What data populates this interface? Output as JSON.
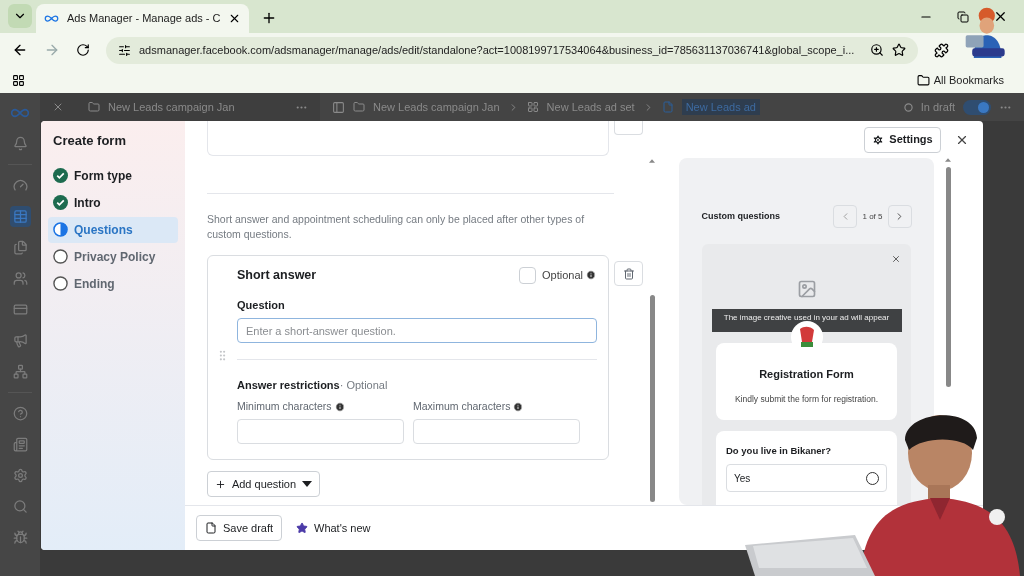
{
  "browser": {
    "tabs": [
      {
        "title": "Ads Manager - Manage ads - C",
        "selected": true
      }
    ],
    "url": "adsmanager.facebook.com/adsmanager/manage/ads/edit/standalone?act=1008199717534064&business_id=785631137036741&global_scope_i...",
    "bookmarks_label": "All Bookmarks"
  },
  "app_bar": {
    "campaign": "New Leads campaign Jan",
    "breadcrumbs": [
      "New Leads campaign Jan",
      "New Leads ad set",
      "New Leads ad"
    ],
    "status": "In draft",
    "toggle_on": true
  },
  "modal": {
    "title": "Create form",
    "steps": [
      {
        "label": "Form type",
        "kind": "complete",
        "selected": false
      },
      {
        "label": "Intro",
        "kind": "complete",
        "selected": false
      },
      {
        "label": "Questions",
        "kind": "current",
        "selected": true
      },
      {
        "label": "Privacy Policy",
        "kind": "incomplete",
        "selected": false
      },
      {
        "label": "Ending",
        "kind": "incomplete",
        "selected": false
      }
    ],
    "note": "Short answer and appointment scheduling can only be placed after other types of custom questions.",
    "question_card": {
      "type_title": "Short answer",
      "optional_label": "Optional",
      "optional_checked": false,
      "question_label": "Question",
      "placeholder": "Enter a short-answer question.",
      "restrictions_title": "Answer restrictions",
      "restrictions_suffix": "· Optional",
      "min_label": "Minimum characters",
      "max_label": "Maximum characters"
    },
    "add_button": "Add question",
    "settings_button": "Settings",
    "footer": {
      "save_draft": "Save draft",
      "whats_new": "What's new"
    },
    "preview": {
      "title": "Custom questions",
      "pager": "1 of 5",
      "image_notice": "The image creative used in your ad will appear",
      "form_title": "Registration Form",
      "form_description": "Kindly submit the form for registration.",
      "question": "Do you live in Bikaner?",
      "options": [
        {
          "label": "Yes",
          "selected": false
        }
      ]
    }
  }
}
